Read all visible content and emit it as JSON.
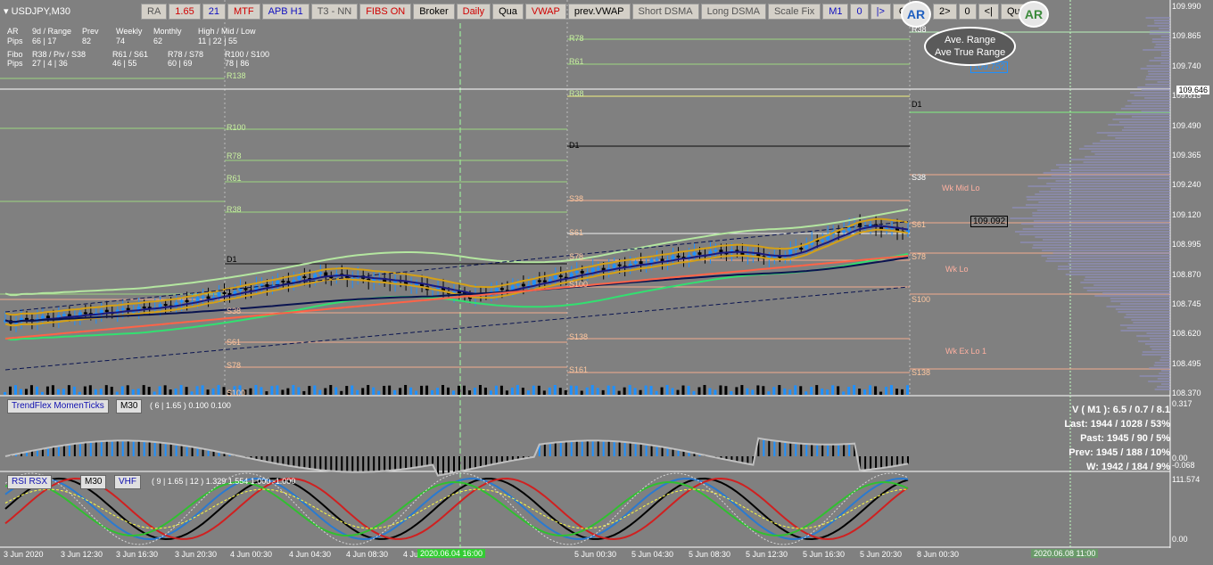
{
  "symbol": "USDJPY,M30",
  "toolbar": [
    {
      "label": "RA",
      "style": "gray"
    },
    {
      "label": "1.65",
      "style": "red"
    },
    {
      "label": "21",
      "style": "blue"
    },
    {
      "label": "MTF",
      "style": "red"
    },
    {
      "label": "APB H1",
      "style": "blue"
    },
    {
      "label": "T3 - NN",
      "style": "gray"
    },
    {
      "label": "FIBS ON",
      "style": "red"
    },
    {
      "label": "Broker",
      "style": ""
    },
    {
      "label": "Daily",
      "style": "red"
    },
    {
      "label": "Qua",
      "style": ""
    },
    {
      "label": "VWAP",
      "style": "red"
    },
    {
      "label": "prev.VWAP",
      "style": ""
    },
    {
      "label": "Short DSMA",
      "style": "gray"
    },
    {
      "label": "Long DSMA",
      "style": "gray"
    },
    {
      "label": "Scale Fix",
      "style": "gray"
    },
    {
      "label": "M1",
      "style": "blue"
    },
    {
      "label": "0",
      "style": "blue"
    },
    {
      "label": "|>",
      "style": "blue"
    },
    {
      "label": "Qu",
      "style": ""
    }
  ],
  "toolbar2": [
    {
      "label": "2>"
    },
    {
      "label": "0"
    },
    {
      "label": "<|"
    },
    {
      "label": "Qu"
    }
  ],
  "stats": {
    "row1": [
      "AR",
      "9d / Range",
      "Prev",
      "Weekly",
      "Monthly",
      "High / Mid / Low"
    ],
    "row2": [
      "Pips",
      "66 | 17",
      "82",
      "74",
      "62",
      "11 | 22 | 55"
    ],
    "row3": [
      "Fibo",
      "R38 / Piv / S38",
      "R61 / S61",
      "R78 / S78",
      "R100 / S100"
    ],
    "row4": [
      "Pips",
      "27 | 4 | 36",
      "46 | 55",
      "60 | 69",
      "78 | 86"
    ]
  },
  "price_axis": [
    "109.990",
    "109.865",
    "109.740",
    "109.615",
    "109.490",
    "109.365",
    "109.240",
    "109.120",
    "108.995",
    "108.870",
    "108.745",
    "108.620",
    "108.495",
    "108.370"
  ],
  "current_price": "109.646",
  "price_box_1": "109.752",
  "price_box_2": "109.092",
  "levels": {
    "left": [
      "R138",
      "R100",
      "R78",
      "R61",
      "R38",
      "D1",
      "S38",
      "S61",
      "S78",
      "S100"
    ],
    "mid": [
      "R78",
      "R61",
      "R38",
      "D1",
      "S38",
      "S61",
      "S78",
      "S100",
      "S138",
      "S161"
    ],
    "right": [
      "R38",
      "D1",
      "S38",
      "S61",
      "S78",
      "S100",
      "S138"
    ],
    "weekly": [
      "Wk Mid Lo",
      "Wk Lo",
      "Wk Ex Lo 1"
    ]
  },
  "trendflex": {
    "title": "TrendFlex MomenTicks",
    "tf": "M30",
    "params": "( 6 | 1.65 ) 0.100 0.100",
    "axis": [
      "0.317",
      "0.00",
      "-0.068"
    ]
  },
  "rsi": {
    "title": "RSI RSX",
    "tf": "M30",
    "vhf": "VHF",
    "params": "( 9 | 1.65 | 12 ) 1.329 1.554 1.000 -1.000",
    "axis": [
      "111.574",
      "0.00"
    ]
  },
  "volume": {
    "line1": "V ( M1 ): 6.5 / 0.7 / 8.1",
    "line2": "Last: 1944 / 1028 / 53%",
    "line3": "Past: 1945 / 90 / 5%",
    "line4": "Prev: 1945 / 188 / 10%",
    "line5": "W: 1942 / 184 / 9%"
  },
  "time_axis": [
    "3 Jun 2020",
    "3 Jun 12:30",
    "3 Jun 16:30",
    "3 Jun 20:30",
    "4 Jun 00:30",
    "4 Jun 04:30",
    "4 Jun 08:30",
    "4 Jun",
    "5 Jun 00:30",
    "5 Jun 04:30",
    "5 Jun 08:30",
    "5 Jun 12:30",
    "5 Jun 16:30",
    "5 Jun 20:30",
    "8 Jun 00:30"
  ],
  "time_highlight": "2020.06.04 16:00",
  "time_highlight_2": "2020.06.08 11:00",
  "ar_badge": "AR",
  "callout": {
    "line1": "Ave. Range",
    "line2": "Ave True Range"
  },
  "colors": {
    "bg": "#808080",
    "bull": "#1e90ff",
    "bear": "#000000",
    "sma_long": "#ff6347",
    "ma_navy": "#0a1450",
    "band_gold": "#d4a017",
    "green_line": "#32e070",
    "light_green": "#b4e6a0"
  }
}
